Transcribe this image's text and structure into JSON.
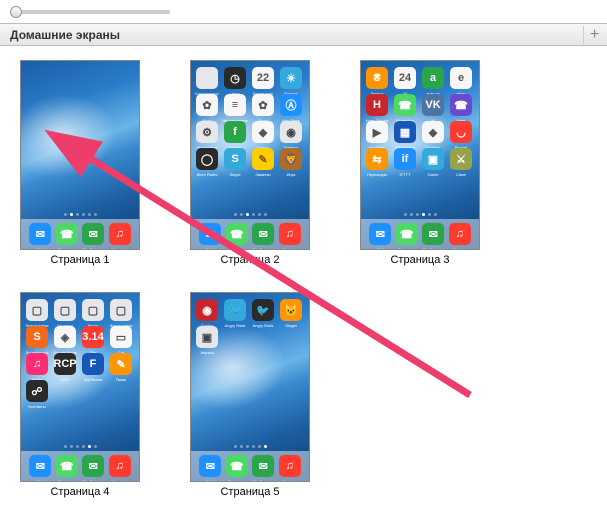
{
  "section_title": "Домашние экраны",
  "add_label": "+",
  "dock": [
    {
      "name": "Mail",
      "cls": "c-blue",
      "glyph": "✉"
    },
    {
      "name": "Телефон",
      "cls": "c-green",
      "glyph": "☎"
    },
    {
      "name": "Сообщения",
      "cls": "c-greenD",
      "glyph": "✉"
    },
    {
      "name": "Музыка",
      "cls": "c-red",
      "glyph": "♫"
    }
  ],
  "pages": [
    {
      "label": "Страница 1",
      "apps": []
    },
    {
      "label": "Страница 2",
      "apps": [
        {
          "name": "Калькулятор",
          "cls": "c-grey",
          "glyph": ""
        },
        {
          "name": "Часы",
          "cls": "c-black",
          "glyph": "◷"
        },
        {
          "name": "Календарь",
          "cls": "c-white",
          "glyph": "22"
        },
        {
          "name": "Погода",
          "cls": "c-sky",
          "glyph": "☀"
        },
        {
          "name": "Фото",
          "cls": "c-white",
          "glyph": "✿"
        },
        {
          "name": "Напоминания",
          "cls": "c-white",
          "glyph": "≡"
        },
        {
          "name": "Фото",
          "cls": "c-white",
          "glyph": "✿"
        },
        {
          "name": "App Store",
          "cls": "c-blue",
          "glyph": "Ⓐ"
        },
        {
          "name": "Настройки",
          "cls": "c-grey",
          "glyph": "⚙"
        },
        {
          "name": "Feedly",
          "cls": "c-greenD",
          "glyph": "f"
        },
        {
          "name": "Карты",
          "cls": "c-white",
          "glyph": "◆"
        },
        {
          "name": "Камера",
          "cls": "c-grey",
          "glyph": "◉"
        },
        {
          "name": "Siren Radio",
          "cls": "c-black",
          "glyph": "◯"
        },
        {
          "name": "Skype",
          "cls": "c-sky",
          "glyph": "S"
        },
        {
          "name": "Заметки",
          "cls": "c-yellow",
          "glyph": "✎"
        },
        {
          "name": "Игра",
          "cls": "c-brown",
          "glyph": "🦁"
        }
      ]
    },
    {
      "label": "Страница 3",
      "apps": [
        {
          "name": "Деньги",
          "cls": "c-orange",
          "glyph": "₴"
        },
        {
          "name": "24",
          "cls": "c-white",
          "glyph": "24"
        },
        {
          "name": "auto.ua",
          "cls": "c-greenD",
          "glyph": "a"
        },
        {
          "name": "ebay",
          "cls": "c-white",
          "glyph": "e"
        },
        {
          "name": "Нова Пошта",
          "cls": "c-redD",
          "glyph": "Н"
        },
        {
          "name": "WhatsApp",
          "cls": "c-green",
          "glyph": "☎"
        },
        {
          "name": "VK",
          "cls": "c-vk",
          "glyph": "VK"
        },
        {
          "name": "Viber",
          "cls": "c-purple",
          "glyph": "☎"
        },
        {
          "name": "YouTube",
          "cls": "c-white",
          "glyph": "▶"
        },
        {
          "name": "Wallpapers",
          "cls": "c-blueD",
          "glyph": "▦"
        },
        {
          "name": "Dropbox",
          "cls": "c-white",
          "glyph": "◆"
        },
        {
          "name": "Pocket",
          "cls": "c-red",
          "glyph": "◡"
        },
        {
          "name": "Перекидач",
          "cls": "c-orange",
          "glyph": "⇆"
        },
        {
          "name": "IFTTT",
          "cls": "c-blue",
          "glyph": "if"
        },
        {
          "name": "Game",
          "cls": "c-sky",
          "glyph": "▣"
        },
        {
          "name": "Clash",
          "cls": "c-olive",
          "glyph": "⚔"
        }
      ]
    },
    {
      "label": "Страница 4",
      "apps": [
        {
          "name": "Фотография",
          "cls": "c-grey",
          "glyph": "▢"
        },
        {
          "name": "Утилиты",
          "cls": "c-grey",
          "glyph": "▢"
        },
        {
          "name": "Книги",
          "cls": "c-grey",
          "glyph": "▢"
        },
        {
          "name": "Фотография",
          "cls": "c-grey",
          "glyph": "▢"
        },
        {
          "name": "Soundhound",
          "cls": "c-orange2",
          "glyph": "S"
        },
        {
          "name": "Google Maps",
          "cls": "c-white",
          "glyph": "◈"
        },
        {
          "name": "Zite",
          "cls": "c-red",
          "glyph": "3.14"
        },
        {
          "name": "Cal",
          "cls": "c-white",
          "glyph": "▭"
        },
        {
          "name": "Music",
          "cls": "c-pink",
          "glyph": "♫"
        },
        {
          "name": "RCP",
          "cls": "c-black",
          "glyph": "RCP"
        },
        {
          "name": "MyFitness",
          "cls": "c-blueD",
          "glyph": "F"
        },
        {
          "name": "Пиши",
          "cls": "c-orange",
          "glyph": "✎"
        },
        {
          "name": "Контакты",
          "cls": "c-black",
          "glyph": "☍"
        }
      ]
    },
    {
      "label": "Страница 5",
      "apps": [
        {
          "name": "Contra",
          "cls": "c-redD",
          "glyph": "◉"
        },
        {
          "name": "Angry Birds",
          "cls": "c-sky",
          "glyph": "🐦"
        },
        {
          "name": "Angry Birds",
          "cls": "c-black",
          "glyph": "🐦"
        },
        {
          "name": "Ginger",
          "cls": "c-orange",
          "glyph": "🐱"
        },
        {
          "name": "Jetpack",
          "cls": "c-grey",
          "glyph": "▣"
        }
      ]
    }
  ]
}
